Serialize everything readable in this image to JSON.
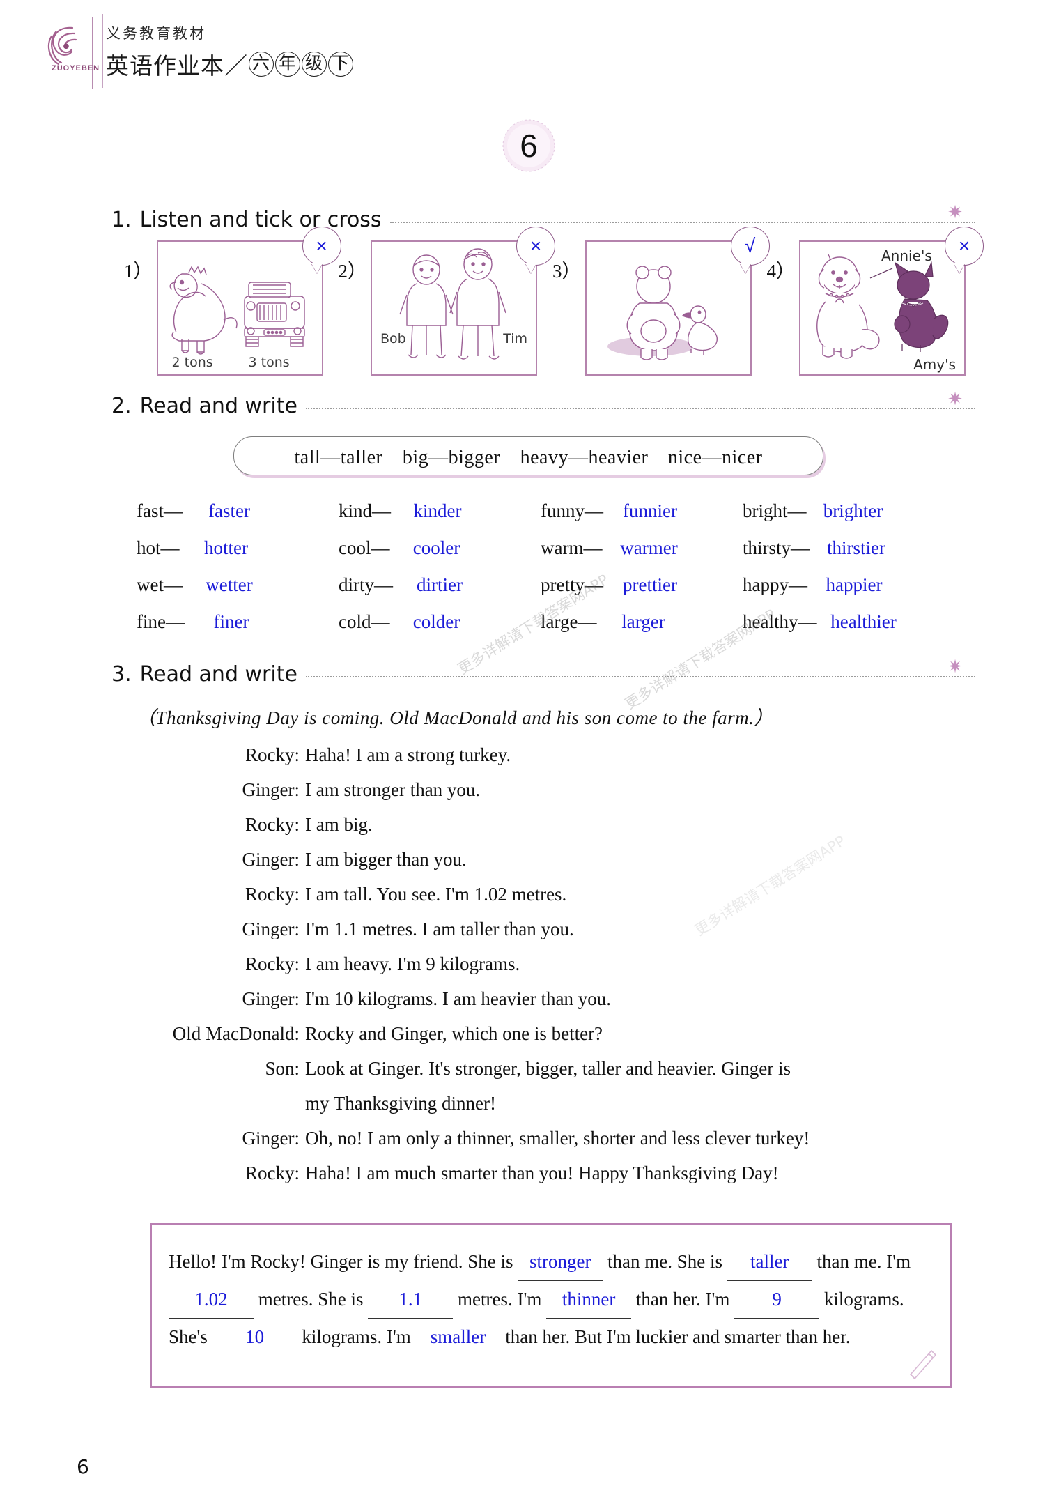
{
  "header": {
    "logo_text": "ZUOYEBEN",
    "subtitle": "义务教育教材",
    "title_main": "英语作业本",
    "title_slash": "／",
    "title_grade": [
      "六",
      "年",
      "级",
      "下"
    ]
  },
  "unit": {
    "number": "6"
  },
  "page_number": "6",
  "watermarks": [
    "更多详解请下载答案网APP",
    "更多详解请下载答案网APP",
    "更多详解请下载答案网APP"
  ],
  "exercise1": {
    "number": "1.",
    "title": "Listen and tick or cross",
    "items": [
      {
        "num": "1）",
        "mark": "×",
        "captions": [
          "2 tons",
          "3 tons"
        ],
        "scene": "dinosaur-and-truck"
      },
      {
        "num": "2）",
        "mark": "×",
        "captions": [
          "Bob",
          "Tim"
        ],
        "scene": "two-boys"
      },
      {
        "num": "3）",
        "mark": "√",
        "captions": [],
        "scene": "bear-and-duck"
      },
      {
        "num": "4）",
        "mark": "×",
        "captions": [
          "Annie's",
          "Amy's"
        ],
        "scene": "dog-and-cat"
      }
    ]
  },
  "exercise2": {
    "number": "2.",
    "title": "Read and write",
    "word_bank": "tall—taller　big—bigger　heavy—heavier　nice—nicer",
    "pairs": [
      {
        "base": "fast—",
        "answer": "faster"
      },
      {
        "base": "kind—",
        "answer": "kinder"
      },
      {
        "base": "funny—",
        "answer": "funnier"
      },
      {
        "base": "bright—",
        "answer": "brighter"
      },
      {
        "base": "hot—",
        "answer": "hotter"
      },
      {
        "base": "cool—",
        "answer": "cooler"
      },
      {
        "base": "warm—",
        "answer": "warmer"
      },
      {
        "base": "thirsty—",
        "answer": "thirstier"
      },
      {
        "base": "wet—",
        "answer": "wetter"
      },
      {
        "base": "dirty—",
        "answer": "dirtier"
      },
      {
        "base": "pretty—",
        "answer": "prettier"
      },
      {
        "base": "happy—",
        "answer": "happier"
      },
      {
        "base": "fine—",
        "answer": "finer"
      },
      {
        "base": "cold—",
        "answer": "colder"
      },
      {
        "base": "large—",
        "answer": "larger"
      },
      {
        "base": "healthy—",
        "answer": "healthier"
      }
    ]
  },
  "exercise3": {
    "number": "3.",
    "title": "Read and write",
    "stage_direction": "（Thanksgiving Day is coming. Old MacDonald and his son come to the farm.）",
    "lines": [
      {
        "speaker": "Rocky:",
        "text": "Haha! I am a strong turkey."
      },
      {
        "speaker": "Ginger:",
        "text": "I am stronger than you."
      },
      {
        "speaker": "Rocky:",
        "text": "I am big."
      },
      {
        "speaker": "Ginger:",
        "text": "I am bigger than you."
      },
      {
        "speaker": "Rocky:",
        "text": "I am tall. You see. I'm 1.02 metres."
      },
      {
        "speaker": "Ginger:",
        "text": "I'm 1.1 metres. I am taller than you."
      },
      {
        "speaker": "Rocky:",
        "text": "I am heavy. I'm 9 kilograms."
      },
      {
        "speaker": "Ginger:",
        "text": "I'm 10 kilograms. I am heavier than you."
      },
      {
        "speaker": "Old MacDonald:",
        "text": "Rocky and Ginger, which one is better?"
      },
      {
        "speaker": "Son:",
        "text": "Look at Ginger. It's stronger, bigger, taller and heavier. Ginger is"
      },
      {
        "speaker": "",
        "text": "my Thanksgiving dinner!",
        "continuation": true
      },
      {
        "speaker": "Ginger:",
        "text": "Oh, no! I am only a thinner, smaller, shorter and less clever turkey!"
      },
      {
        "speaker": "Rocky:",
        "text": "Haha! I am much smarter than you! Happy Thanksgiving Day!"
      }
    ]
  },
  "summary": {
    "t1": "Hello! I'm Rocky! Ginger is my friend. She is",
    "a1": "stronger",
    "t2": "than me.",
    "t3": "She is",
    "a2": "taller",
    "t4": "than me. I'm",
    "a3": "1.02",
    "t5": "metres. She is",
    "a4": "1.1",
    "t6": "metres.",
    "t7": "I'm",
    "a5": "thinner",
    "t8": "than her. I'm",
    "a6": "9",
    "t9": "kilograms. She's",
    "a7": "10",
    "t10": "kilograms. I'm",
    "a8": "smaller",
    "t11": "than her. But I'm luckier and smarter than her."
  },
  "colors": {
    "answer_blue": "#1b1bd8",
    "accent_purple": "#b583ad",
    "rule_purple": "#b88cb0"
  }
}
